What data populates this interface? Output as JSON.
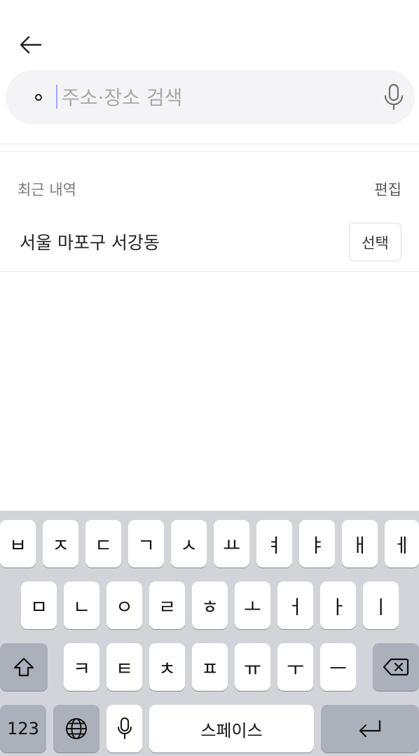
{
  "header": {
    "back_icon": "arrow-left-icon"
  },
  "search": {
    "placeholder": "주소·장소 검색",
    "leading_icon": "dot-icon",
    "mic_icon": "microphone-icon"
  },
  "recent": {
    "title": "최근 내역",
    "edit_label": "편집",
    "items": [
      {
        "label": "서울 마포구 서강동",
        "select_label": "선택"
      }
    ]
  },
  "keyboard": {
    "row1": [
      "ㅂ",
      "ㅈ",
      "ㄷ",
      "ㄱ",
      "ㅅ",
      "ㅛ",
      "ㅕ",
      "ㅑ",
      "ㅐ",
      "ㅔ"
    ],
    "row2": [
      "ㅁ",
      "ㄴ",
      "ㅇ",
      "ㄹ",
      "ㅎ",
      "ㅗ",
      "ㅓ",
      "ㅏ",
      "ㅣ"
    ],
    "row3": [
      "ㅋ",
      "ㅌ",
      "ㅊ",
      "ㅍ",
      "ㅠ",
      "ㅜ",
      "ㅡ"
    ],
    "numbers_label": "123",
    "space_label": "스페이스",
    "shift_icon": "shift-icon",
    "backspace_icon": "backspace-icon",
    "globe_icon": "globe-icon",
    "mic_icon": "microphone-icon",
    "return_icon": "return-icon"
  }
}
